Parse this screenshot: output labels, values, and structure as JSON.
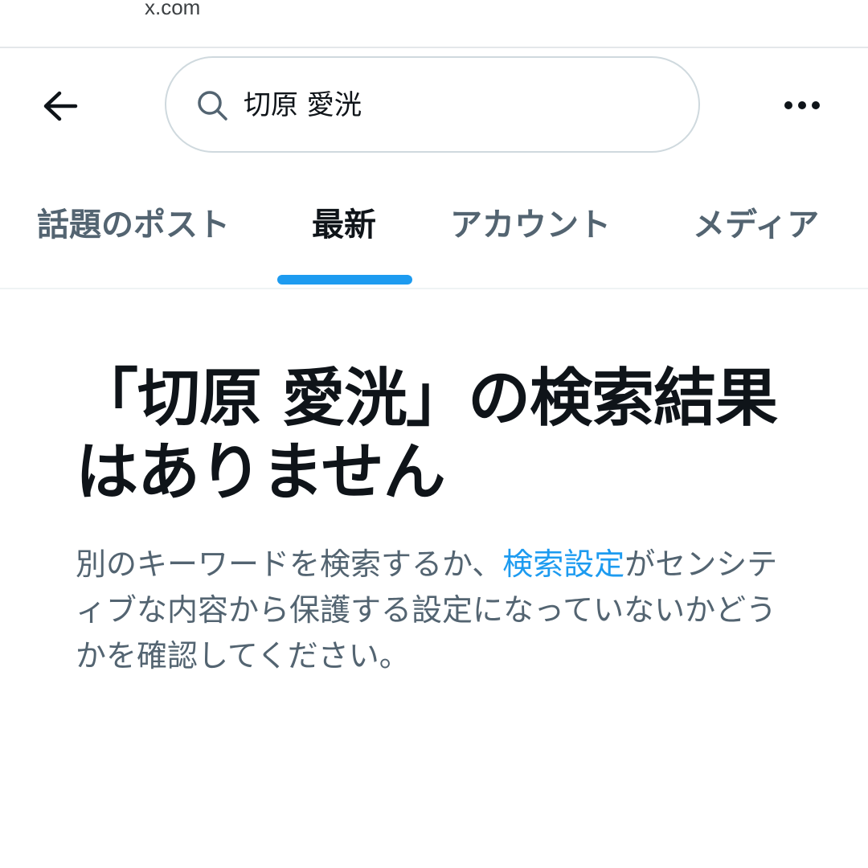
{
  "browser": {
    "url": "x.com"
  },
  "header": {
    "back_icon": "arrow-left-icon",
    "search": {
      "icon": "search-icon",
      "value": "切原 愛洸"
    },
    "more_icon": "more-horizontal-icon"
  },
  "tabs": [
    {
      "label": "話題のポスト",
      "active": false
    },
    {
      "label": "最新",
      "active": true
    },
    {
      "label": "アカウント",
      "active": false
    },
    {
      "label": "メディア",
      "active": false
    }
  ],
  "empty_state": {
    "title": "「切原 愛洸」の検索結果はありません",
    "description_before": "別のキーワードを検索するか、",
    "description_link": "検索設定",
    "description_after": "がセンシティブな内容から保護する設定になっていないかどうかを確認してください。"
  },
  "colors": {
    "accent": "#1d9bf0",
    "text_primary": "#0f1419",
    "text_secondary": "#536471",
    "border": "#cfd9de"
  }
}
